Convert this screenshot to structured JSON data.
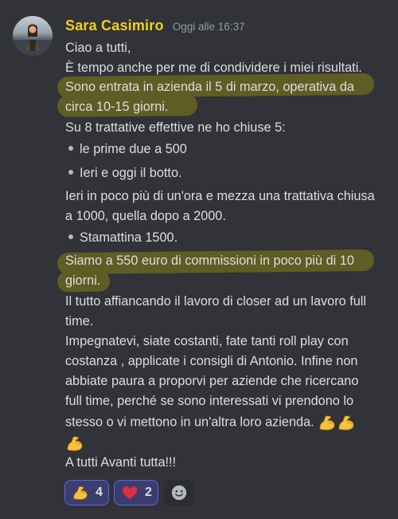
{
  "message": {
    "author": "Sara Casimiro",
    "timestamp": "Oggi alle 16:37",
    "author_color": "#f0d21b",
    "highlight_color": "#5f5d24",
    "lines": [
      "Ciao a tutti,",
      "È tempo anche per me di condividere i miei risultati.",
      "Sono entrata in azienda il 5 di marzo, operativa da",
      "circa 10-15 giorni.",
      "Su 8 trattative effettive ne ho chiuse 5:",
      "le prime due a 500",
      "Ieri e oggi il botto.",
      "Ieri in poco più di un'ora e mezza una trattativa chiusa",
      "a 1000, quella dopo a 2000.",
      "Stamattina 1500.",
      "Siamo a 550 euro di commissioni in poco più di 10",
      "giorni.",
      "Il tutto affiancando il lavoro di closer ad un lavoro full",
      "time.",
      "Impegnatevi, siate costanti,  fate tanti roll play con",
      "costanza , applicate i consigli di Antonio. Infine non",
      "abbiate paura a proporvi per aziende che ricercano",
      "full time, perché se sono interessati vi prendono lo",
      "stesso o vi mettono in un'altra loro azienda.",
      "A tutti Avanti tutta!!!"
    ],
    "inline_emoji": "flexed-biceps"
  },
  "reactions": [
    {
      "emoji": "flexed-biceps",
      "count": "4"
    },
    {
      "emoji": "red-heart",
      "count": "2"
    }
  ],
  "add_reaction_icon": "smiley-add-reaction-icon"
}
